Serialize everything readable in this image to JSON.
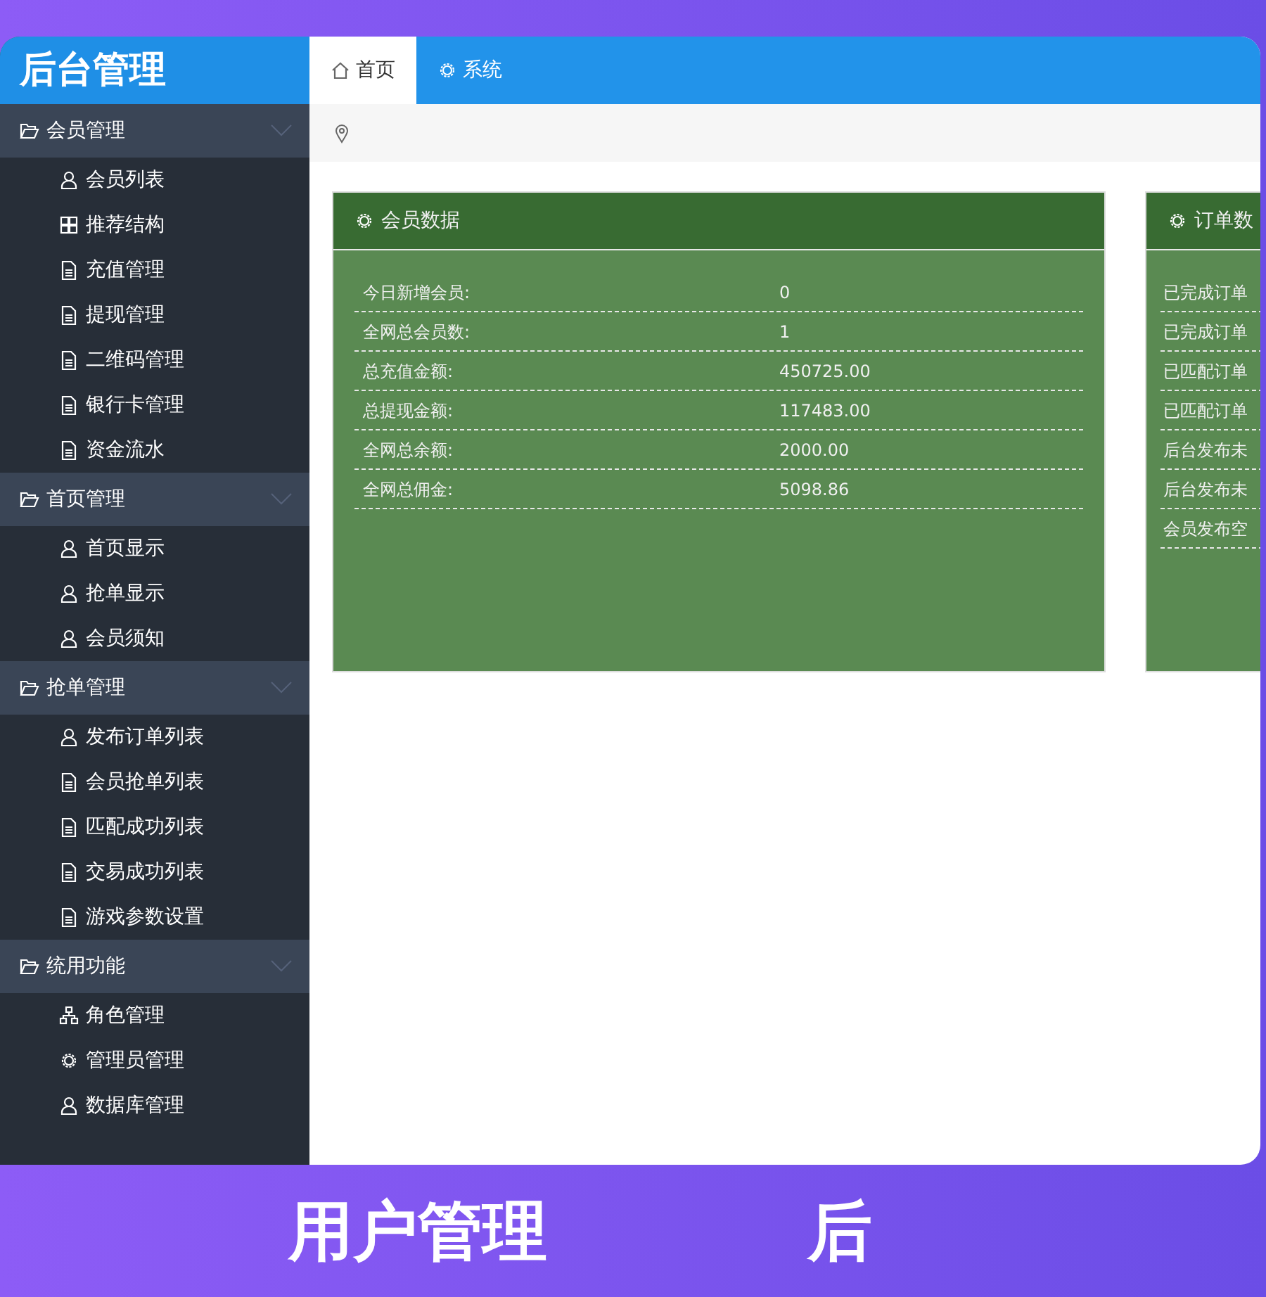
{
  "sidebar": {
    "title": "后台管理",
    "groups": [
      {
        "label": "会员管理",
        "expanded": true,
        "items": [
          {
            "label": "会员列表",
            "kind": "user"
          },
          {
            "label": "推荐结构",
            "kind": "grid"
          },
          {
            "label": "充值管理",
            "kind": "doc"
          },
          {
            "label": "提现管理",
            "kind": "doc"
          },
          {
            "label": "二维码管理",
            "kind": "doc"
          },
          {
            "label": "银行卡管理",
            "kind": "doc"
          },
          {
            "label": "资金流水",
            "kind": "doc"
          }
        ]
      },
      {
        "label": "首页管理",
        "expanded": true,
        "items": [
          {
            "label": "首页显示",
            "kind": "user"
          },
          {
            "label": "抢单显示",
            "kind": "user"
          },
          {
            "label": "会员须知",
            "kind": "user"
          }
        ]
      },
      {
        "label": "抢单管理",
        "expanded": true,
        "items": [
          {
            "label": "发布订单列表",
            "kind": "user"
          },
          {
            "label": "会员抢单列表",
            "kind": "doc"
          },
          {
            "label": "匹配成功列表",
            "kind": "doc"
          },
          {
            "label": "交易成功列表",
            "kind": "doc"
          },
          {
            "label": "游戏参数设置",
            "kind": "doc"
          }
        ]
      },
      {
        "label": "统用功能",
        "expanded": true,
        "items": [
          {
            "label": "角色管理",
            "kind": "tree"
          },
          {
            "label": "管理员管理",
            "kind": "gear"
          },
          {
            "label": "数据库管理",
            "kind": "user"
          }
        ]
      }
    ]
  },
  "tabs": [
    {
      "label": "首页",
      "kind": "home",
      "selected": true
    },
    {
      "label": "系统",
      "kind": "gear",
      "selected": false
    }
  ],
  "cards": [
    {
      "title": "会员数据",
      "rows": [
        {
          "label": "今日新增会员:",
          "value": "0"
        },
        {
          "label": "全网总会员数:",
          "value": "1"
        },
        {
          "label": "总充值金额:",
          "value": "450725.00"
        },
        {
          "label": "总提现金额:",
          "value": "117483.00"
        },
        {
          "label": "全网总余额:",
          "value": "2000.00"
        },
        {
          "label": "全网总佣金:",
          "value": "5098.86"
        }
      ]
    },
    {
      "title": "订单数",
      "rows": [
        {
          "label": "已完成订单"
        },
        {
          "label": "已完成订单"
        },
        {
          "label": "已匹配订单"
        },
        {
          "label": "已匹配订单"
        },
        {
          "label": "后台发布未"
        },
        {
          "label": "后台发布未"
        },
        {
          "label": "会员发布空"
        }
      ]
    }
  ],
  "captions": [
    "用户管理",
    "后"
  ]
}
